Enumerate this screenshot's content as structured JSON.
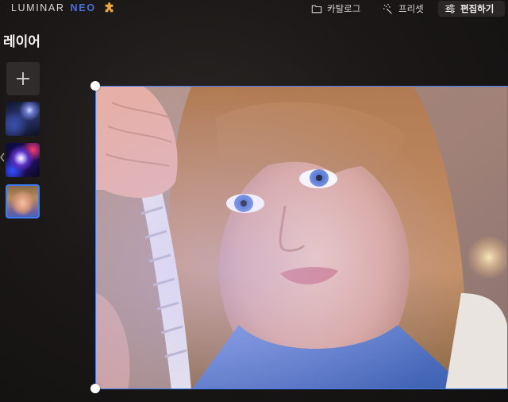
{
  "app": {
    "logo_primary": "LUMINAR",
    "logo_secondary": "NEO",
    "brand_color": "#4a6fd6",
    "extensions_icon": "puzzle-icon"
  },
  "nav": {
    "catalog": {
      "label": "카탈로그",
      "icon": "folder-icon"
    },
    "presets": {
      "label": "프리셋",
      "icon": "sparkle-wand-icon"
    },
    "edit": {
      "label": "편집하기",
      "icon": "sliders-icon",
      "active": true
    }
  },
  "layers_panel": {
    "title": "레이어",
    "add_button_icon": "plus-icon",
    "layers": [
      {
        "name": "layer-1",
        "description": "blue abstract light"
      },
      {
        "name": "layer-2",
        "description": "purple light orb"
      },
      {
        "name": "layer-3",
        "description": "girl portrait",
        "selected": true
      }
    ]
  },
  "canvas": {
    "selection_color": "#3f7cf0",
    "image": "portrait of a girl holding a rope"
  }
}
